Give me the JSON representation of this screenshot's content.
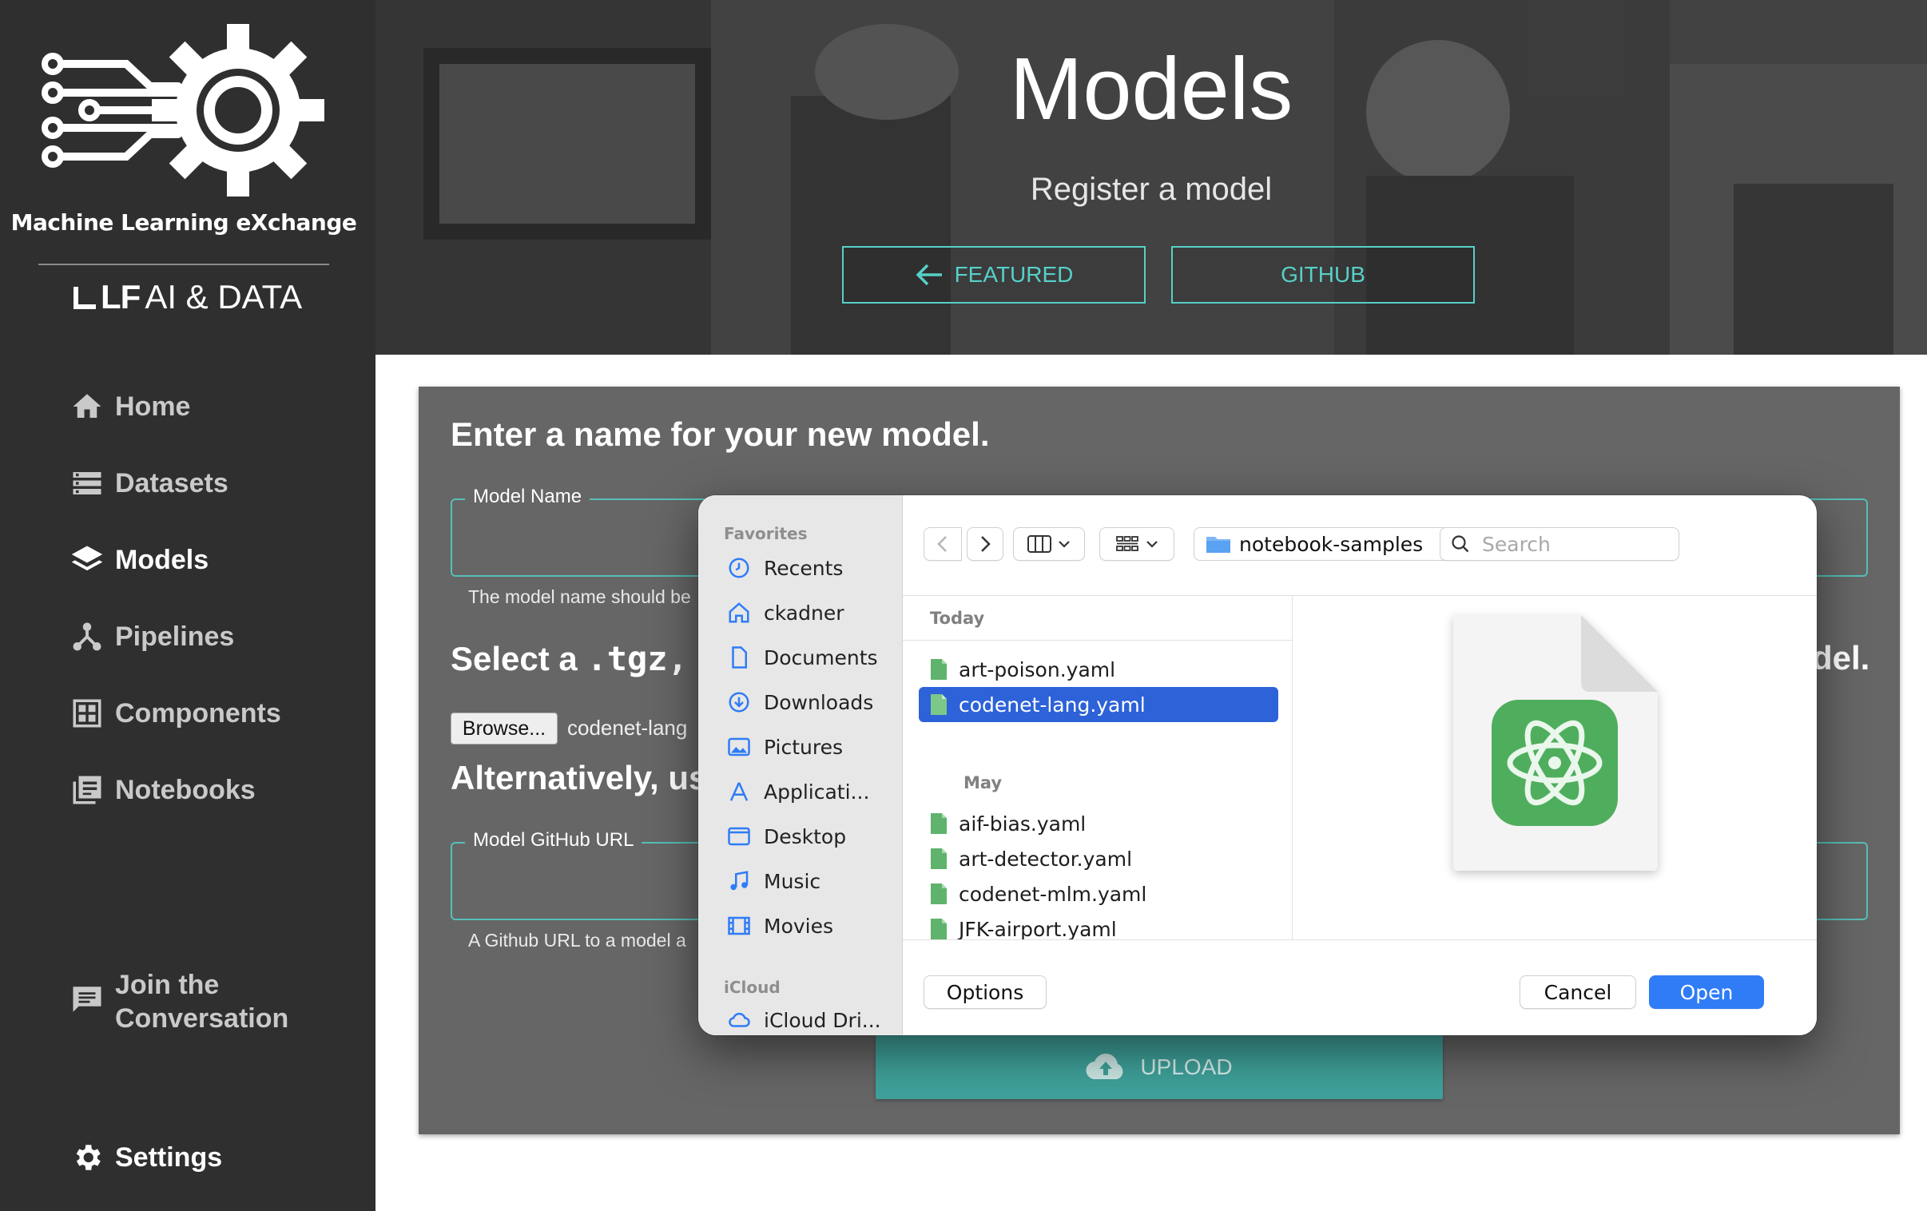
{
  "sidebar": {
    "brand": "Machine Learning eXchange",
    "lf_mark": "LF",
    "lf_rest": "AI & DATA",
    "nav": [
      {
        "label": "Home",
        "icon": "home-icon"
      },
      {
        "label": "Datasets",
        "icon": "datasets-icon"
      },
      {
        "label": "Models",
        "icon": "models-icon",
        "active": true
      },
      {
        "label": "Pipelines",
        "icon": "pipelines-icon"
      },
      {
        "label": "Components",
        "icon": "components-icon"
      },
      {
        "label": "Notebooks",
        "icon": "notebooks-icon"
      }
    ],
    "join": {
      "line1": "Join the",
      "line2": "Conversation",
      "icon": "chat-icon"
    },
    "settings": {
      "label": "Settings",
      "icon": "gear-icon"
    }
  },
  "hero": {
    "title": "Models",
    "subtitle": "Register a model",
    "featured_label": "FEATURED",
    "github_label": "GITHUB"
  },
  "form": {
    "heading": "Enter a name for your new model.",
    "name_label": "Model Name",
    "name_helper": "The model name should be",
    "select_prefix": "Select a ",
    "select_code": ".tgz, .",
    "select_tail": "del.",
    "browse_label": "Browse...",
    "browse_file": "codenet-lang",
    "alt_heading": "Alternatively, us",
    "url_label": "Model GitHub URL",
    "url_helper": "A Github URL to a model a",
    "upload_label": "UPLOAD"
  },
  "dialog": {
    "favorites_label": "Favorites",
    "favorites": [
      {
        "label": "Recents",
        "icon": "clock-icon"
      },
      {
        "label": "ckadner",
        "icon": "house-icon"
      },
      {
        "label": "Documents",
        "icon": "document-icon"
      },
      {
        "label": "Downloads",
        "icon": "download-icon"
      },
      {
        "label": "Pictures",
        "icon": "photo-icon"
      },
      {
        "label": "Applicati...",
        "icon": "applications-icon"
      },
      {
        "label": "Desktop",
        "icon": "desktop-icon"
      },
      {
        "label": "Music",
        "icon": "music-icon"
      },
      {
        "label": "Movies",
        "icon": "film-icon"
      }
    ],
    "icloud_label": "iCloud",
    "icloud_item": "iCloud Dri...",
    "folder": "notebook-samples",
    "search_placeholder": "Search",
    "today_label": "Today",
    "may_label": "May",
    "today_files": [
      "art-poison.yaml",
      "codenet-lang.yaml"
    ],
    "may_files": [
      "aif-bias.yaml",
      "art-detector.yaml",
      "codenet-mlm.yaml",
      "JFK-airport.yaml"
    ],
    "selected_file": "codenet-lang.yaml",
    "options_label": "Options",
    "cancel_label": "Cancel",
    "open_label": "Open"
  },
  "colors": {
    "sidebar_bg": "#2f2f2f",
    "accent_teal": "#56d0c8",
    "card_bg": "#666666",
    "upload_bg": "#3fa29b",
    "mac_blue": "#2f7cf6",
    "selection_blue": "#2d62d8"
  }
}
